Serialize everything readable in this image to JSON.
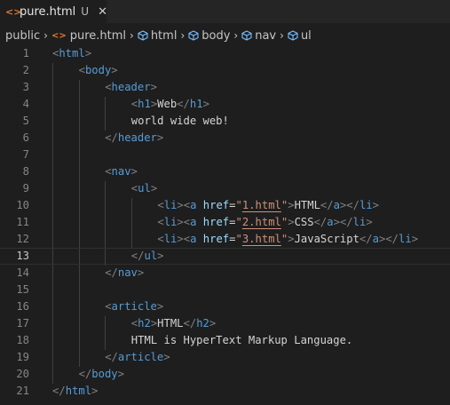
{
  "tab": {
    "file_icon": "<>",
    "label": "pure.html",
    "status": "U",
    "close": "✕"
  },
  "breadcrumb": {
    "items": [
      "public",
      "pure.html",
      "html",
      "body",
      "nav",
      "ul"
    ]
  },
  "editor": {
    "current_line": 13,
    "line_numbers": [
      "1",
      "2",
      "3",
      "4",
      "5",
      "6",
      "7",
      "8",
      "9",
      "10",
      "11",
      "12",
      "13",
      "14",
      "15",
      "16",
      "17",
      "18",
      "19",
      "20",
      "21"
    ],
    "lines": [
      "<html>",
      "<body>",
      "<header>",
      "<h1>Web</h1>",
      "world wide web!",
      "</header>",
      "",
      "<nav>",
      "<ul>",
      "<li><a href=\"1.html\">HTML</a></li>",
      "<li><a href=\"2.html\">CSS</a></li>",
      "<li><a href=\"3.html\">JavaScript</a></li>",
      "</ul>",
      "</nav>",
      "",
      "<article>",
      "<h2>HTML</h2>",
      "HTML is HyperText Markup Language.",
      "</article>",
      "</body>",
      "</html>"
    ]
  },
  "colors": {
    "background": "#1e1e1e",
    "tag": "#569cd6",
    "attribute": "#9cdcfe",
    "string": "#ce9178",
    "punctuation": "#808080",
    "text": "#d4d4d4",
    "line_number": "#858585"
  }
}
